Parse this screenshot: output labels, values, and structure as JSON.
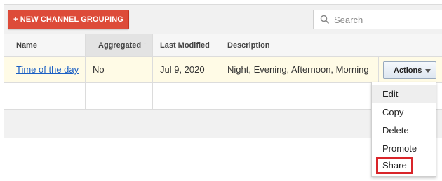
{
  "toolbar": {
    "new_button_label": "+ NEW CHANNEL GROUPING",
    "search_placeholder": "Search"
  },
  "table": {
    "columns": [
      "Name",
      "Aggregated",
      "Last Modified",
      "Description"
    ],
    "sort_indicator": "↑",
    "rows": [
      {
        "name": "Time of the day",
        "aggregated": "No",
        "last_modified": "Jul 9, 2020",
        "description": "Night, Evening, Afternoon, Morning"
      }
    ]
  },
  "actions": {
    "button_label": "Actions",
    "menu_items": [
      "Edit",
      "Copy",
      "Delete",
      "Promote",
      "Share"
    ]
  },
  "colors": {
    "primary_button": "#dd4b39",
    "link": "#1a5fc4",
    "highlight_box": "#d9252a",
    "selected_row": "#fffbe6"
  }
}
